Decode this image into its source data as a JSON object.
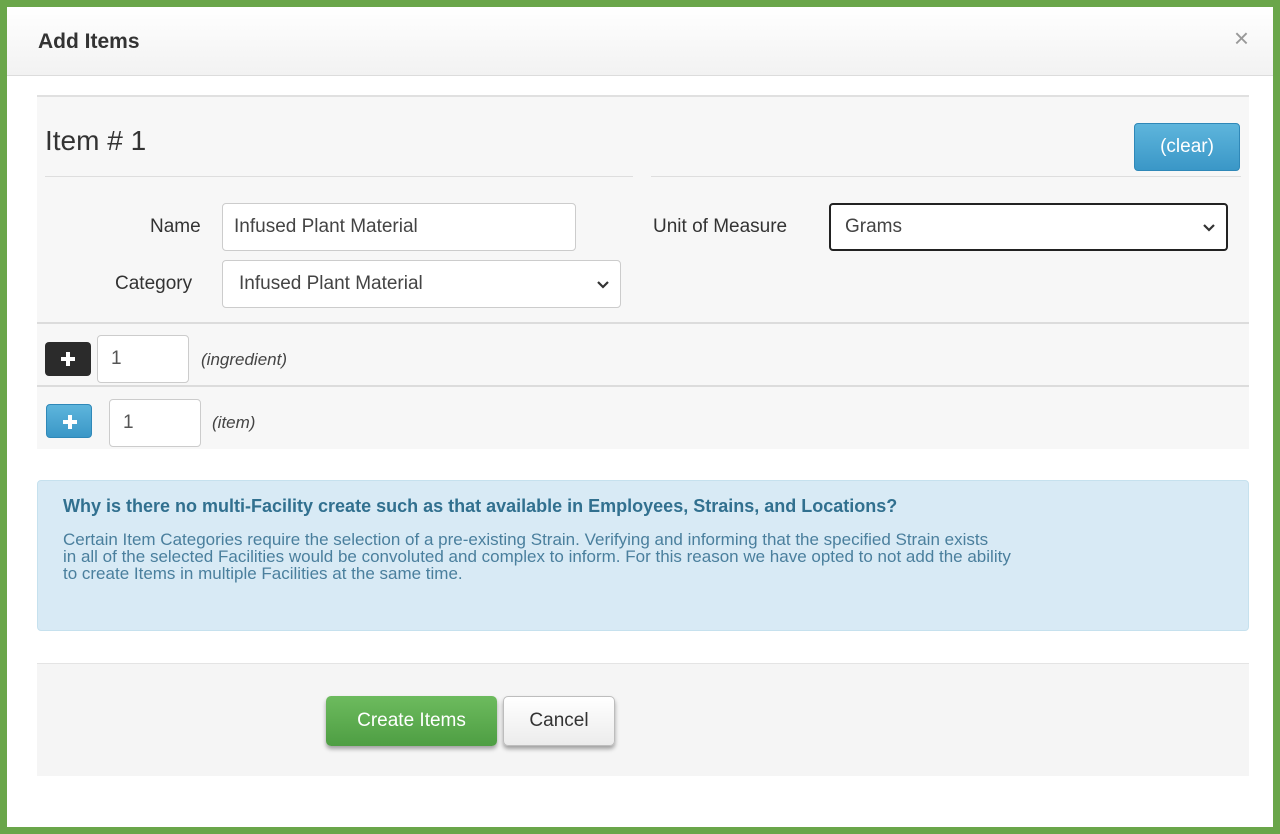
{
  "modal": {
    "title": "Add Items",
    "close_label": "×"
  },
  "item": {
    "heading": "Item # 1",
    "clear_label": "(clear)"
  },
  "form": {
    "name_label": "Name",
    "name_value": "Infused Plant Material",
    "category_label": "Category",
    "category_value": "Infused Plant Material",
    "uom_label": "Unit of Measure",
    "uom_value": "Grams"
  },
  "ingredient_row": {
    "count": "1",
    "hint": "(ingredient)"
  },
  "item_row": {
    "count": "1",
    "hint": "(item)"
  },
  "info": {
    "title": "Why is there no multi-Facility create such as that available in Employees, Strains, and Locations?",
    "lines": [
      "Certain Item Categories require the selection of a pre-existing Strain. Verifying and informing that the specified Strain exists",
      "in all of the selected Facilities would be convoluted and complex to inform. For this reason we have opted to not add the ability",
      "to create Items in multiple Facilities at the same time."
    ]
  },
  "footer": {
    "create_label": "Create Items",
    "cancel_label": "Cancel"
  },
  "colors": {
    "frame_border": "#6aa64a",
    "primary_blue": "#3a97c7",
    "success_green": "#4e9e43",
    "info_bg": "#d8eaf5"
  }
}
